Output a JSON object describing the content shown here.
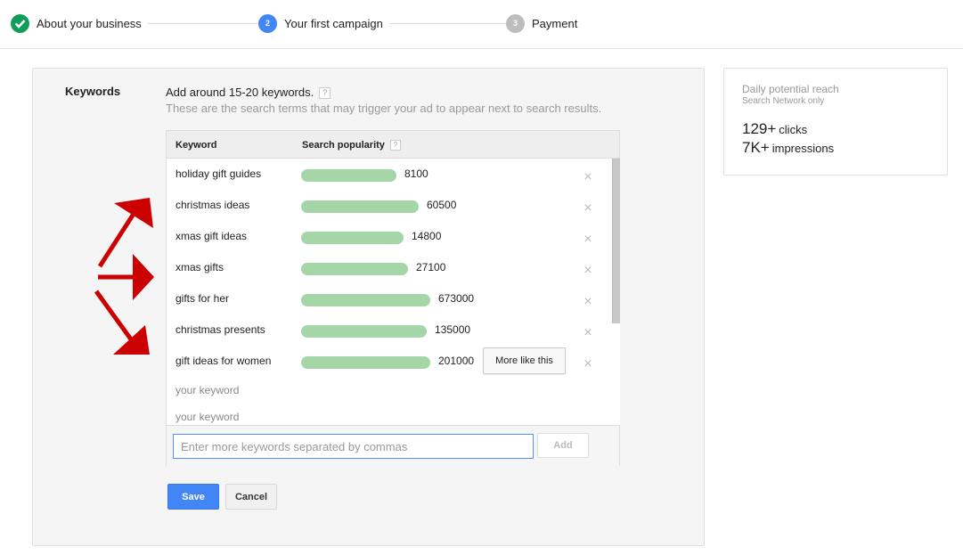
{
  "stepper": {
    "steps": [
      {
        "number": "",
        "label": "About your business",
        "state": "done",
        "icon": "check-icon"
      },
      {
        "number": "2",
        "label": "Your first campaign",
        "state": "active"
      },
      {
        "number": "3",
        "label": "Payment",
        "state": "pending"
      }
    ]
  },
  "keywords_section": {
    "label": "Keywords",
    "intro": "Add around 15-20 keywords.",
    "help_glyph": "?",
    "subtitle": "These are the search terms that may trigger your ad to appear next to search results.",
    "table": {
      "columns": [
        "Keyword",
        "Search popularity"
      ],
      "bar_color": "#a5d6a7",
      "rows": [
        {
          "keyword": "holiday gift guides",
          "popularity": "8100",
          "relative_popularity": 0.74
        },
        {
          "keyword": "christmas ideas",
          "popularity": "60500",
          "relative_popularity": 0.91
        },
        {
          "keyword": "xmas gift ideas",
          "popularity": "14800",
          "relative_popularity": 0.79
        },
        {
          "keyword": "xmas gifts",
          "popularity": "27100",
          "relative_popularity": 0.83
        },
        {
          "keyword": "gifts for her",
          "popularity": "673000",
          "relative_popularity": 1.0
        },
        {
          "keyword": "christmas presents",
          "popularity": "135000",
          "relative_popularity": 0.97
        },
        {
          "keyword": "gift ideas for women",
          "popularity": "201000",
          "relative_popularity": 1.0
        }
      ],
      "placeholders": [
        "your keyword",
        "your keyword"
      ],
      "more_like_this_label": "More like this",
      "remove_glyph": "×"
    },
    "input": {
      "value": "",
      "placeholder": "Enter more keywords separated by commas"
    },
    "add_label": "Add"
  },
  "actions": {
    "save_label": "Save",
    "cancel_label": "Cancel"
  },
  "reach": {
    "title": "Daily potential reach",
    "subtitle": "Search Network only",
    "clicks_value": "129+",
    "clicks_unit": "clicks",
    "impressions_value": "7K+",
    "impressions_unit": "impressions"
  },
  "colors": {
    "primary": "#4285f4",
    "success": "#0f9d58",
    "annotation_arrow": "#cc0000"
  }
}
